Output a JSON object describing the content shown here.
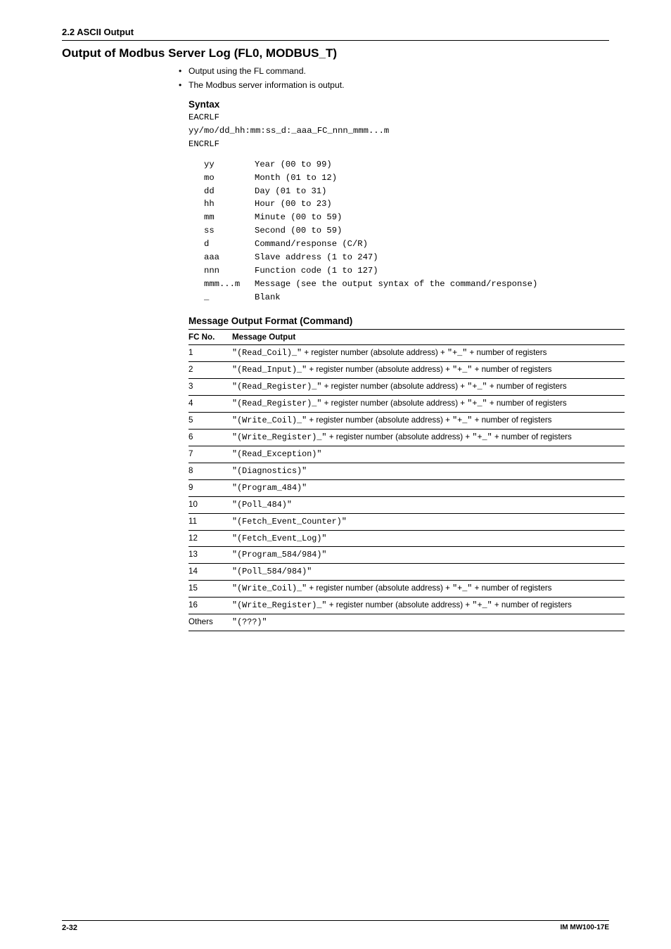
{
  "header": {
    "section": "2.2  ASCII Output"
  },
  "title": "Output of Modbus Server Log (FL0, MODBUS_T)",
  "bullets": [
    "Output using the FL command.",
    "The Modbus server information is output."
  ],
  "syntax": {
    "heading": "Syntax",
    "lines": [
      "EACRLF",
      "yy/mo/dd_hh:mm:ss_d:_aaa_FC_nnn_mmm...m",
      "ENCRLF"
    ],
    "fields": [
      {
        "k": "yy",
        "v": "Year (00 to 99)"
      },
      {
        "k": "mo",
        "v": "Month (01 to 12)"
      },
      {
        "k": "dd",
        "v": "Day (01 to 31)"
      },
      {
        "k": "hh",
        "v": "Hour (00 to 23)"
      },
      {
        "k": "mm",
        "v": "Minute (00 to 59)"
      },
      {
        "k": "ss",
        "v": "Second (00 to 59)"
      },
      {
        "k": "d",
        "v": "Command/response (C/R)"
      },
      {
        "k": "aaa",
        "v": "Slave address (1 to 247)"
      },
      {
        "k": "nnn",
        "v": "Function code (1 to 127)"
      },
      {
        "k": "mmm...m",
        "v": "Message (see the output syntax of the command/response)"
      },
      {
        "k": "_",
        "v": "Blank"
      }
    ]
  },
  "msg": {
    "heading": "Message Output Format (Command)",
    "cols": [
      "FC No.",
      "Message Output"
    ],
    "rows": [
      {
        "fc": "1",
        "segs": [
          {
            "t": "mono",
            "v": "\"(Read_Coil)_\""
          },
          {
            "t": "text",
            "v": " + register number (absolute address) + "
          },
          {
            "t": "mono",
            "v": "\"+_\""
          },
          {
            "t": "text",
            "v": " + number of registers"
          }
        ]
      },
      {
        "fc": "2",
        "segs": [
          {
            "t": "mono",
            "v": "\"(Read_Input)_\""
          },
          {
            "t": "text",
            "v": " + register number (absolute address) + "
          },
          {
            "t": "mono",
            "v": "\"+_\""
          },
          {
            "t": "text",
            "v": " + number of registers"
          }
        ]
      },
      {
        "fc": "3",
        "segs": [
          {
            "t": "mono",
            "v": "\"(Read_Register)_\""
          },
          {
            "t": "text",
            "v": " + register number (absolute address) + "
          },
          {
            "t": "mono",
            "v": "\"+_\""
          },
          {
            "t": "text",
            "v": " + number of registers"
          }
        ]
      },
      {
        "fc": "4",
        "segs": [
          {
            "t": "mono",
            "v": "\"(Read_Register)_\""
          },
          {
            "t": "text",
            "v": " + register number (absolute address) + "
          },
          {
            "t": "mono",
            "v": "\"+_\""
          },
          {
            "t": "text",
            "v": " + number of registers"
          }
        ]
      },
      {
        "fc": "5",
        "segs": [
          {
            "t": "mono",
            "v": "\"(Write_Coil)_\""
          },
          {
            "t": "text",
            "v": " + register number (absolute address) + "
          },
          {
            "t": "mono",
            "v": "\"+_\""
          },
          {
            "t": "text",
            "v": " + number of registers"
          }
        ]
      },
      {
        "fc": "6",
        "segs": [
          {
            "t": "mono",
            "v": "\"(Write_Register)_\""
          },
          {
            "t": "text",
            "v": "  + register number (absolute address) + "
          },
          {
            "t": "mono",
            "v": "\"+_\""
          },
          {
            "t": "text",
            "v": " + number of registers"
          }
        ]
      },
      {
        "fc": "7",
        "segs": [
          {
            "t": "mono",
            "v": "\"(Read_Exception)\""
          }
        ]
      },
      {
        "fc": "8",
        "segs": [
          {
            "t": "mono",
            "v": "\"(Diagnostics)\""
          }
        ]
      },
      {
        "fc": "9",
        "segs": [
          {
            "t": "mono",
            "v": "\"(Program_484)\""
          }
        ]
      },
      {
        "fc": "10",
        "segs": [
          {
            "t": "mono",
            "v": "\"(Poll_484)\""
          }
        ]
      },
      {
        "fc": "11",
        "segs": [
          {
            "t": "mono",
            "v": "\"(Fetch_Event_Counter)\""
          }
        ]
      },
      {
        "fc": "12",
        "segs": [
          {
            "t": "mono",
            "v": "\"(Fetch_Event_Log)\""
          }
        ]
      },
      {
        "fc": "13",
        "segs": [
          {
            "t": "mono",
            "v": "\"(Program_584/984)\""
          }
        ]
      },
      {
        "fc": "14",
        "segs": [
          {
            "t": "mono",
            "v": "\"(Poll_584/984)\""
          }
        ]
      },
      {
        "fc": "15",
        "segs": [
          {
            "t": "mono",
            "v": "\"(Write_Coil)_\""
          },
          {
            "t": "text",
            "v": " + register number (absolute address) + "
          },
          {
            "t": "mono",
            "v": "\"+_\""
          },
          {
            "t": "text",
            "v": " + number of registers"
          }
        ]
      },
      {
        "fc": "16",
        "segs": [
          {
            "t": "mono",
            "v": "\"(Write_Register)_\""
          },
          {
            "t": "text",
            "v": " + register number (absolute address) + "
          },
          {
            "t": "mono",
            "v": "\"+_\""
          },
          {
            "t": "text",
            "v": " + number of registers"
          }
        ]
      },
      {
        "fc": "Others",
        "segs": [
          {
            "t": "mono",
            "v": "\"(???)\""
          }
        ]
      }
    ]
  },
  "footer": {
    "page": "2-32",
    "doc": "IM MW100-17E"
  }
}
